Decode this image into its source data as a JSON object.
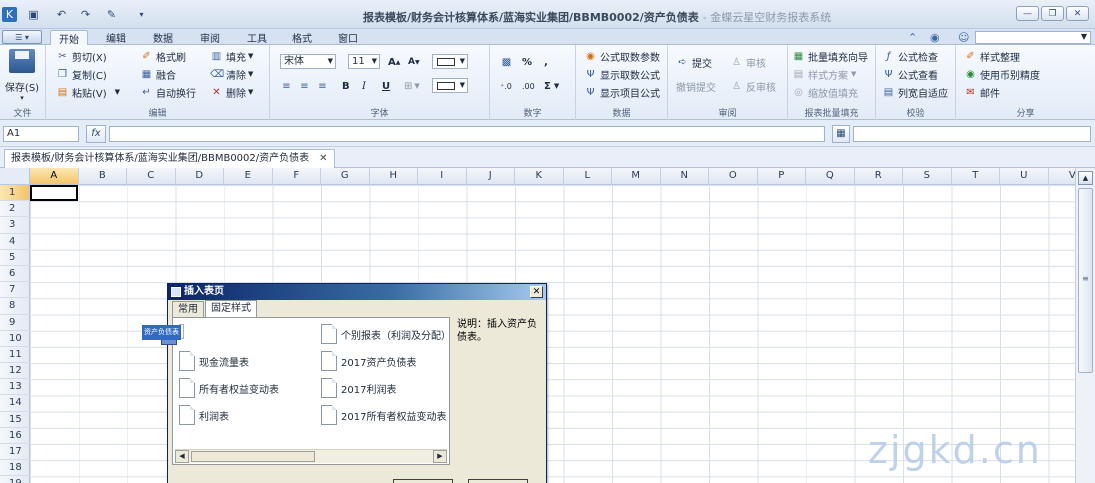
{
  "titlebar": {
    "title": "报表模板/财务会计核算体系/蓝海实业集团/BBMB0002/资产负债表",
    "suffix": "- 金蝶云星空财务报表系统"
  },
  "tabs": [
    "开始",
    "编辑",
    "数据",
    "审阅",
    "工具",
    "格式",
    "窗口"
  ],
  "ribbon": {
    "file": {
      "save": "保存(S)",
      "label": "文件"
    },
    "edit": {
      "cut": "剪切(X)",
      "copy": "复制(C)",
      "paste": "粘贴(V)",
      "format_painter": "格式刷",
      "merge": "融合",
      "auto_wrap": "自动换行",
      "fill": "填充",
      "clear": "清除",
      "delete": "删除",
      "label": "编辑"
    },
    "font": {
      "family": "宋体",
      "size": "11",
      "bold": "B",
      "italic": "I",
      "underline": "U",
      "label": "字体"
    },
    "number": {
      "percent": "%",
      "comma": ",",
      "sum": "Σ",
      "label": "数字"
    },
    "data": {
      "formula_params": "公式取数参数",
      "show_formula": "显示取数公式",
      "show_project": "显示项目公式",
      "label": "数据"
    },
    "review": {
      "submit": "提交",
      "audit": "审核",
      "withdraw": "撤销提交",
      "unaudit": "反审核",
      "label": "审阅"
    },
    "batch": {
      "wizard": "批量填充向导",
      "style_plan": "样式方案",
      "fill_pos": "缩放值填充",
      "label": "报表批量填充"
    },
    "check": {
      "formula_check": "公式检查",
      "formula_view": "公式查看",
      "col_width": "列宽自适应",
      "label": "校验"
    },
    "share": {
      "style_sort": "样式整理",
      "use_precision": "使用币别精度",
      "mail": "邮件",
      "label": "分享"
    }
  },
  "formula_bar": {
    "cell_ref": "A1",
    "fx": "fx"
  },
  "doc_tab": {
    "label": "报表模板/财务会计核算体系/蓝海实业集团/BBMB0002/资产负债表",
    "close": "✕"
  },
  "sheet": {
    "columns": [
      "A",
      "B",
      "C",
      "D",
      "E",
      "F",
      "G",
      "H",
      "I",
      "J",
      "K",
      "L",
      "M",
      "N",
      "O",
      "P",
      "Q",
      "R",
      "S",
      "T",
      "U",
      "V"
    ],
    "rows": [
      "1",
      "2",
      "3",
      "4",
      "5",
      "6",
      "7",
      "8",
      "9",
      "10",
      "11",
      "12",
      "13",
      "14",
      "15",
      "16",
      "17",
      "18",
      "19"
    ]
  },
  "dialog": {
    "title": "插入表页",
    "tabs": [
      "常用",
      "固定样式"
    ],
    "items": [
      "资产负债表",
      "现金流量表",
      "所有者权益变动表",
      "利润表",
      "个别报表（利润及分配）",
      "2017资产负债表",
      "2017利润表",
      "2017所有者权益变动表"
    ],
    "description": "说明：插入资产负债表。"
  },
  "watermark": "zjgkd.cn",
  "colors": {
    "accent": "#316ac5",
    "ribbon": "#e2ebf6",
    "dialog_title": "#0a246a"
  }
}
